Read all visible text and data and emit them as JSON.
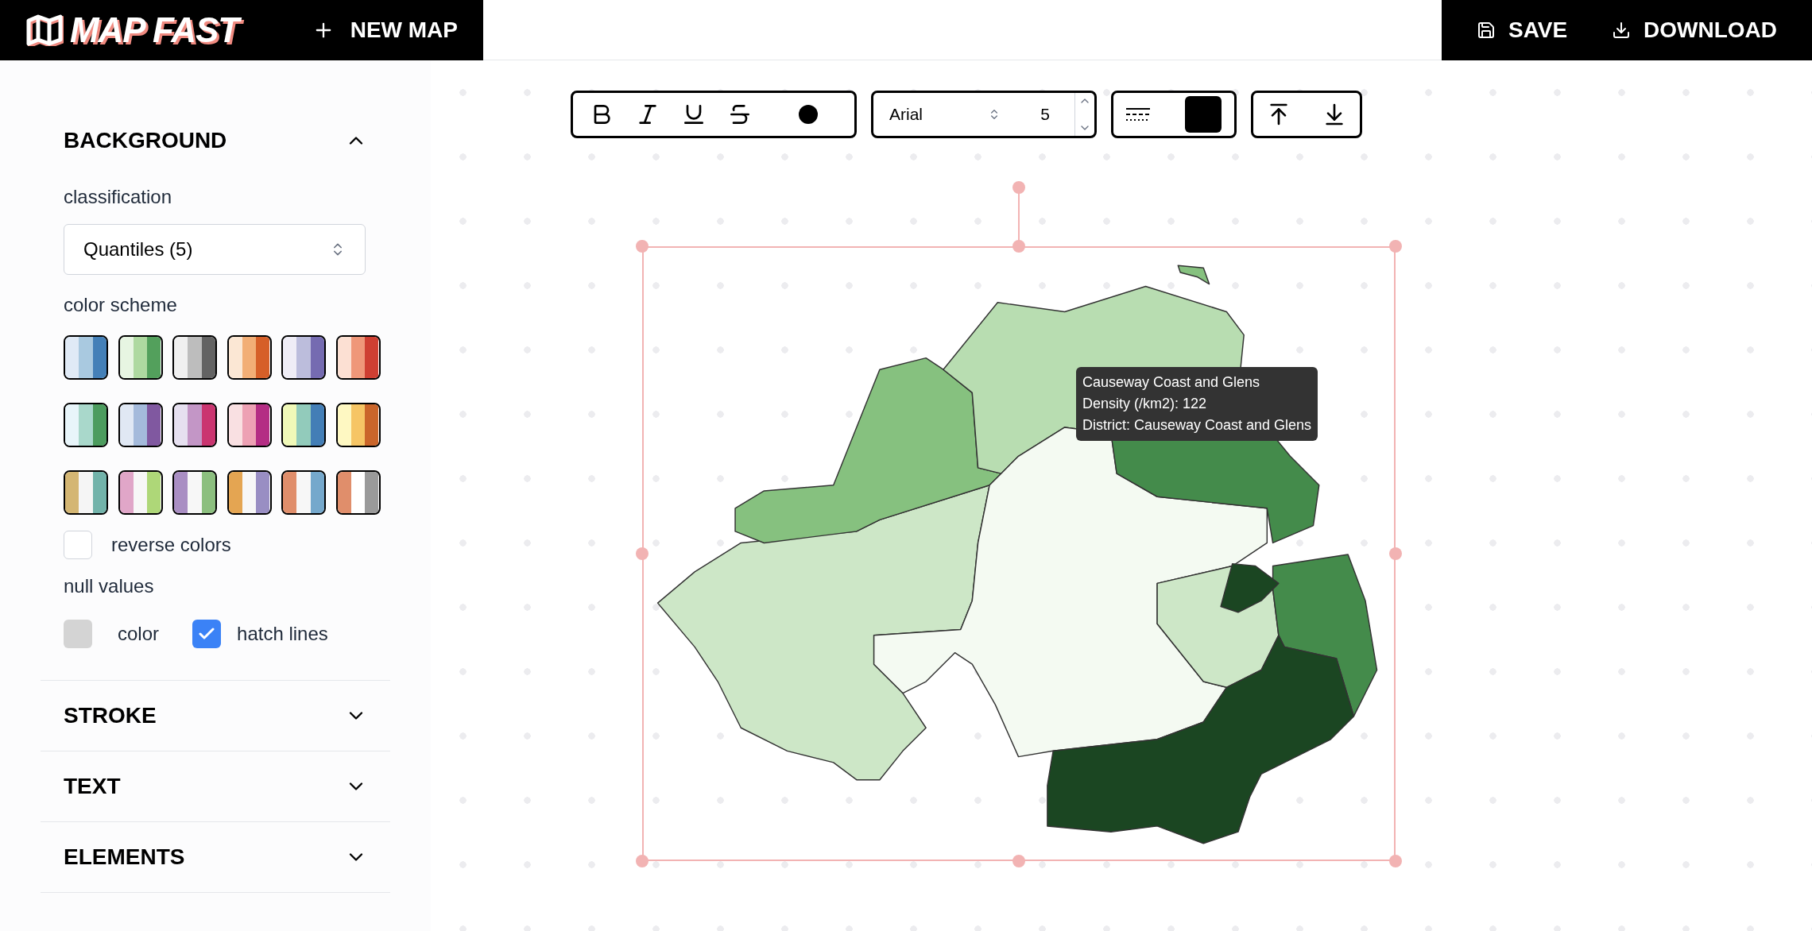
{
  "header": {
    "logo": "MAP FAST",
    "new_map": "NEW MAP",
    "actions": [
      "SAVE",
      "DOWNLOAD"
    ]
  },
  "sidebar": {
    "sections": [
      {
        "title": "BACKGROUND",
        "expanded": true
      },
      {
        "title": "STROKE",
        "expanded": false
      },
      {
        "title": "TEXT",
        "expanded": false
      },
      {
        "title": "ELEMENTS",
        "expanded": false
      }
    ]
  },
  "background": {
    "classification_label": "classification",
    "classification": "Quantiles (5)",
    "scheme_label": "color scheme",
    "schemes": [
      {
        "stripes": [
          {
            "color": "#e0eaf6"
          },
          {
            "color": "#a9c9e0"
          },
          {
            "color": "#4480b8"
          }
        ]
      },
      {
        "stripes": [
          {
            "color": "#e7f5e2"
          },
          {
            "color": "#aed9a0"
          },
          {
            "color": "#53a05c"
          }
        ]
      },
      {
        "stripes": [
          {
            "color": "#f0f0f0"
          },
          {
            "color": "#bdbdbd"
          },
          {
            "color": "#636363"
          }
        ]
      },
      {
        "stripes": [
          {
            "color": "#fbe7d4"
          },
          {
            "color": "#f2ae76"
          },
          {
            "color": "#d65f28"
          }
        ]
      },
      {
        "stripes": [
          {
            "color": "#efedf6"
          },
          {
            "color": "#bcbddc"
          },
          {
            "color": "#756bb1"
          }
        ]
      },
      {
        "stripes": [
          {
            "color": "#fce0d3"
          },
          {
            "color": "#ef9779"
          },
          {
            "color": "#ce3f32"
          }
        ]
      },
      {
        "stripes": [
          {
            "color": "#e8f5fa"
          },
          {
            "color": "#a9d8cb"
          },
          {
            "color": "#4c9c5e"
          }
        ]
      },
      {
        "stripes": [
          {
            "color": "#e0e8f4"
          },
          {
            "color": "#a4badb"
          },
          {
            "color": "#8058a0"
          }
        ]
      },
      {
        "stripes": [
          {
            "color": "#e6e0f0"
          },
          {
            "color": "#c396c6"
          },
          {
            "color": "#ca3570"
          }
        ]
      },
      {
        "stripes": [
          {
            "color": "#f9e0e2"
          },
          {
            "color": "#eda1b4"
          },
          {
            "color": "#b42d84"
          }
        ]
      },
      {
        "stripes": [
          {
            "color": "#f0f9b8"
          },
          {
            "color": "#92cbbb"
          },
          {
            "color": "#437eb6"
          }
        ]
      },
      {
        "stripes": [
          {
            "color": "#fef8c2"
          },
          {
            "color": "#f6c565"
          },
          {
            "color": "#ca652a"
          }
        ]
      },
      {
        "stripes": [
          {
            "color": "#d4b673"
          },
          {
            "color": "#f5f5f5"
          },
          {
            "color": "#72b3aa"
          }
        ]
      },
      {
        "stripes": [
          {
            "color": "#e0a6c8"
          },
          {
            "color": "#f7f7f7"
          },
          {
            "color": "#aed778"
          }
        ]
      },
      {
        "stripes": [
          {
            "color": "#a98ec3"
          },
          {
            "color": "#f7f7f7"
          },
          {
            "color": "#8cbf7f"
          }
        ]
      },
      {
        "stripes": [
          {
            "color": "#e4a552"
          },
          {
            "color": "#f7f7f7"
          },
          {
            "color": "#998ec3"
          }
        ]
      },
      {
        "stripes": [
          {
            "color": "#e08e6b"
          },
          {
            "color": "#f7f7f7"
          },
          {
            "color": "#75a8cc"
          }
        ]
      },
      {
        "stripes": [
          {
            "color": "#e08e6b"
          },
          {
            "color": "#ffffff"
          },
          {
            "color": "#9a9a9a"
          }
        ]
      }
    ],
    "reverse": {
      "label": "reverse colors",
      "checked": false
    },
    "null_label": "null values",
    "null_color": {
      "label": "color",
      "color": "#d4d4d4"
    },
    "hatch": {
      "label": "hatch lines",
      "checked": true
    }
  },
  "toolbar": {
    "font": "Arial",
    "size": "5"
  },
  "tooltip": [
    "Causeway Coast and Glens",
    "Density (/km2): 122",
    "District: Causeway Coast and Glens"
  ]
}
